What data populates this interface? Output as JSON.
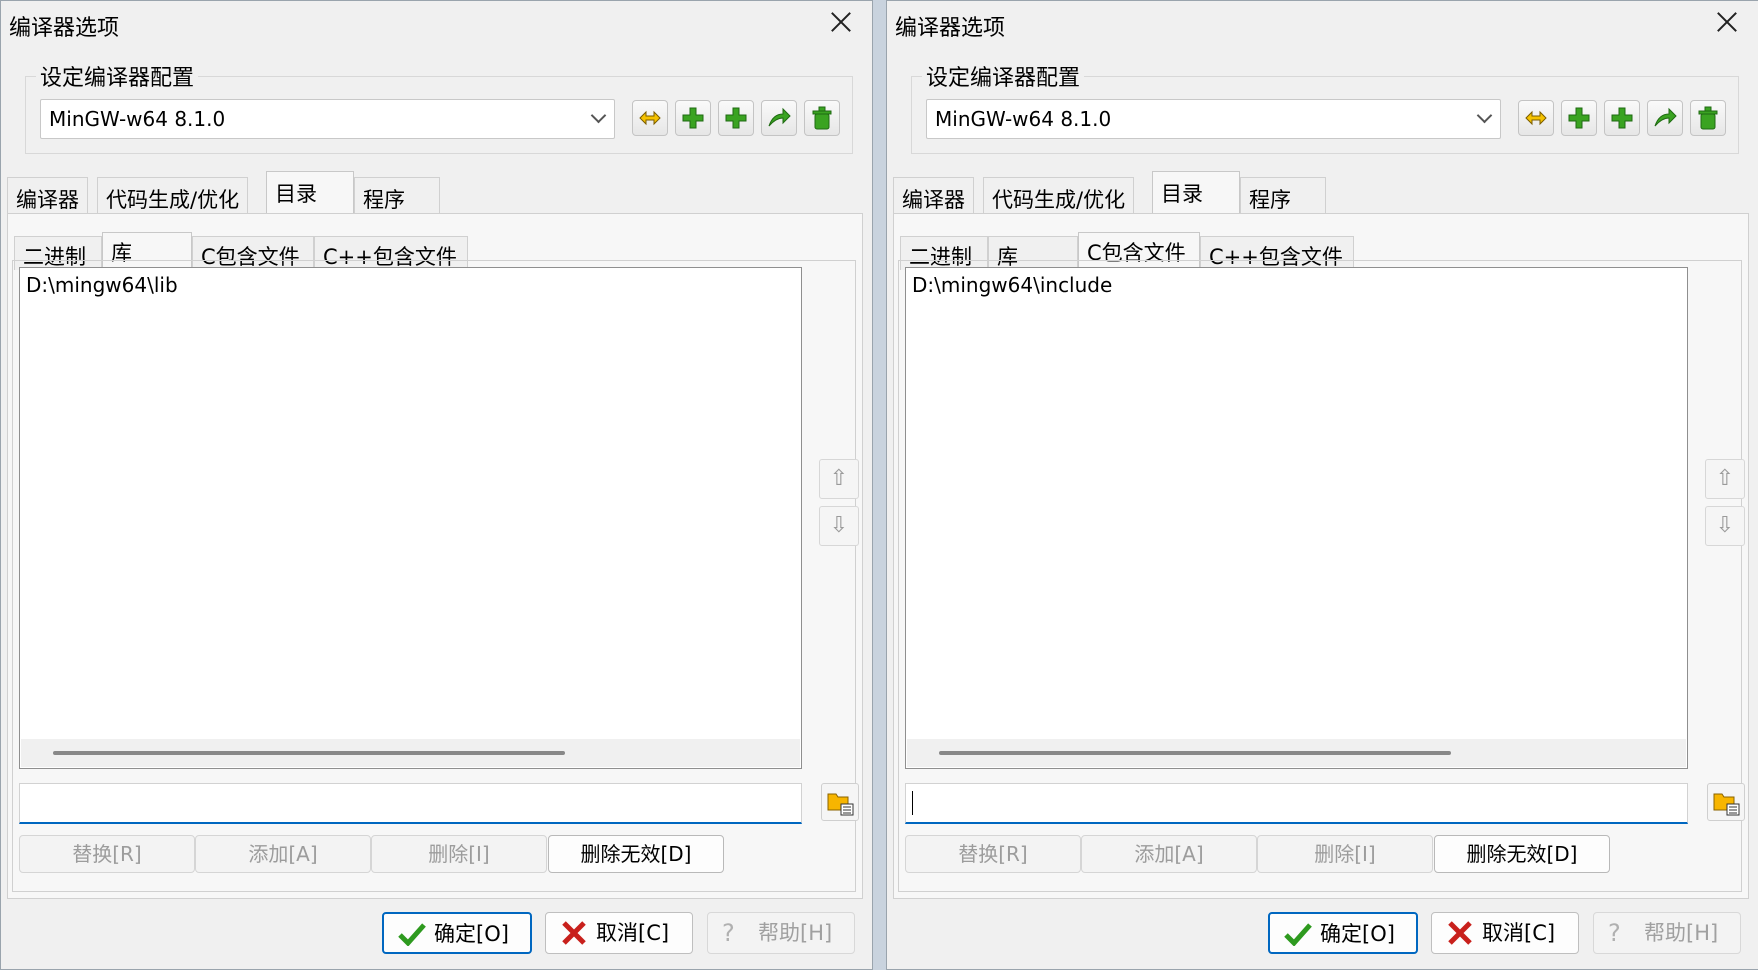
{
  "windows": [
    {
      "title": "编译器选项",
      "config_group_label": "设定编译器配置",
      "compiler_select_value": "MinGW-w64 8.1.0",
      "tabs": [
        "编译器",
        "代码生成/优化",
        "目录",
        "程序"
      ],
      "active_tab": "目录",
      "subtabs": [
        "二进制",
        "库",
        "C包含文件",
        "C++包含文件"
      ],
      "active_subtab": "库",
      "list_items": [
        "D:\\mingw64\\lib"
      ],
      "path_input_value": "",
      "action_buttons": [
        "替换[R]",
        "添加[A]",
        "删除[I]",
        "删除无效[D]"
      ],
      "footer": {
        "ok_label": "确定[O]",
        "cancel_label": "取消[C]",
        "help_label": "帮助[H]"
      }
    },
    {
      "title": "编译器选项",
      "config_group_label": "设定编译器配置",
      "compiler_select_value": "MinGW-w64 8.1.0",
      "tabs": [
        "编译器",
        "代码生成/优化",
        "目录",
        "程序"
      ],
      "active_tab": "目录",
      "subtabs": [
        "二进制",
        "库",
        "C包含文件",
        "C++包含文件"
      ],
      "active_subtab": "C包含文件",
      "list_items": [
        "D:\\mingw64\\include"
      ],
      "path_input_value": "",
      "action_buttons": [
        "替换[R]",
        "添加[A]",
        "删除[I]",
        "删除无效[D]"
      ],
      "footer": {
        "ok_label": "确定[O]",
        "cancel_label": "取消[C]",
        "help_label": "帮助[H]"
      }
    }
  ],
  "toolbar_icons": [
    "rename-config-icon",
    "add-config-icon",
    "add-config-copy-icon",
    "restore-default-icon",
    "delete-config-icon"
  ],
  "colors": {
    "accent": "#0067c0",
    "icon_green": "#3aa321",
    "icon_yellow": "#f5c200"
  }
}
